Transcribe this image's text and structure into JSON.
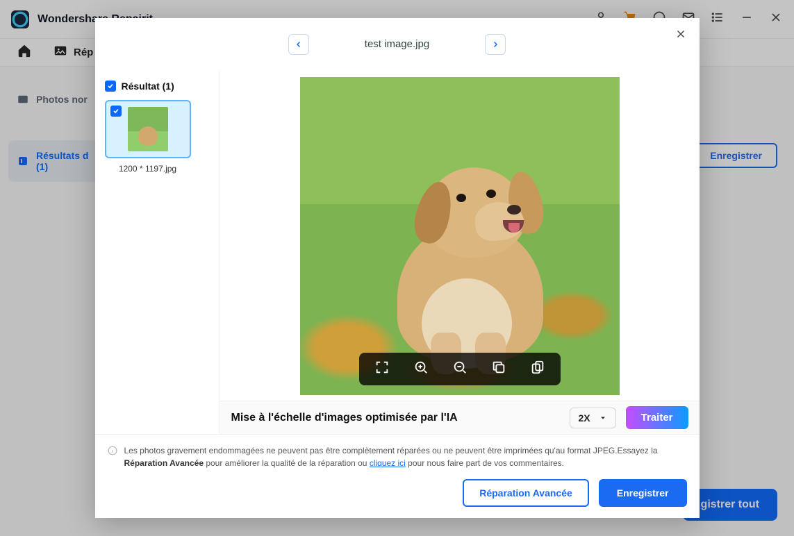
{
  "titlebar": {
    "app_name": "Wondershare Repairit"
  },
  "tabstrip": {
    "label": "Rép"
  },
  "sidebar": {
    "items": [
      {
        "label": "Photos nor"
      },
      {
        "label": "Résultats d",
        "count": "(1)"
      }
    ]
  },
  "background_buttons": {
    "save": "Enregistrer",
    "save_all": "gistrer tout"
  },
  "modal": {
    "filename": "test image.jpg",
    "results": {
      "heading": "Résultat (1)",
      "thumb_caption": "1200 * 1197.jpg"
    },
    "upscale": {
      "label": "Mise à l'échelle d'images optimisée par l'IA",
      "multiplier": "2X",
      "process": "Traiter"
    },
    "info": {
      "text_a": "Les photos gravement endommagées ne peuvent pas être complètement réparées ou ne peuvent être imprimées qu'au format JPEG.Essayez la ",
      "bold_a": "Réparation Avancée",
      "text_b": " pour améliorer la qualité de la réparation ou ",
      "link": "cliquez ici",
      "text_c": " pour nous faire part de vos commentaires."
    },
    "footer": {
      "advanced": "Réparation Avancée",
      "save": "Enregistrer"
    }
  }
}
